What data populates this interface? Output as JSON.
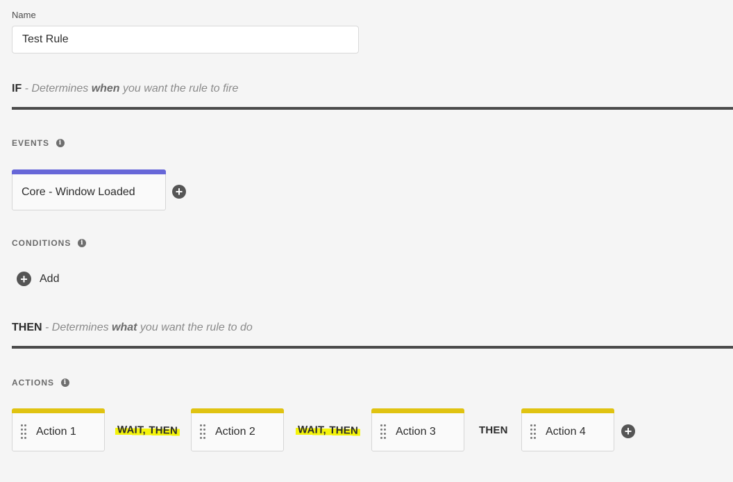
{
  "name": {
    "label": "Name",
    "value": "Test Rule"
  },
  "if_section": {
    "keyword": "IF",
    "desc_pre": " - Determines ",
    "desc_bold": "when",
    "desc_post": " you want the rule to fire"
  },
  "events": {
    "label": "EVENTS",
    "info_icon": "info-icon",
    "items": [
      {
        "label": "Core - Window Loaded",
        "accent": "#6767d8"
      }
    ]
  },
  "conditions": {
    "label": "CONDITIONS",
    "info_icon": "info-icon",
    "add_label": "Add"
  },
  "then_section": {
    "keyword": "THEN",
    "desc_pre": " - Determines ",
    "desc_bold": "what",
    "desc_post": " you want the rule to do"
  },
  "actions": {
    "label": "ACTIONS",
    "info_icon": "info-icon",
    "accent": "#e0c311",
    "items": [
      {
        "label": "Action 1"
      },
      {
        "label": "Action 2"
      },
      {
        "label": "Action 3"
      },
      {
        "label": "Action 4"
      }
    ],
    "connectors": [
      {
        "label": "WAIT, THEN",
        "highlighted": true
      },
      {
        "label": "WAIT, THEN",
        "highlighted": true
      },
      {
        "label": "THEN",
        "highlighted": false
      }
    ]
  },
  "highlight_color": "#f4f40a"
}
